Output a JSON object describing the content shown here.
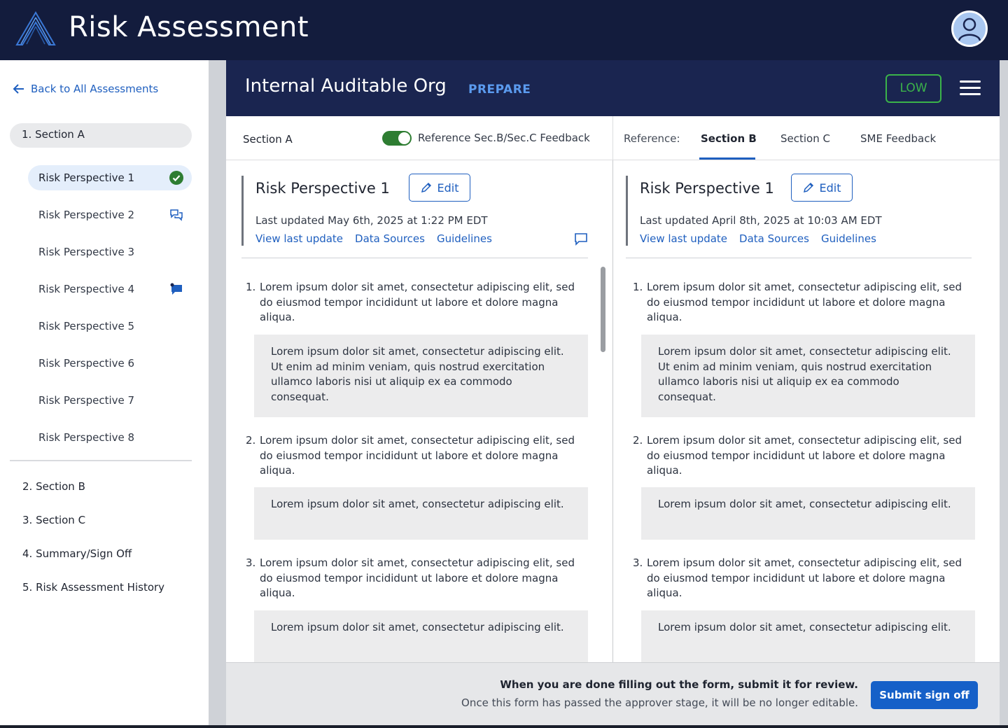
{
  "app": {
    "title": "Risk Assessment"
  },
  "sidebar": {
    "back_label": "Back to All Assessments",
    "current_section": "1. Section A",
    "perspectives": [
      {
        "label": "Risk Perspective 1",
        "status": "complete-check-icon",
        "active": true
      },
      {
        "label": "Risk Perspective 2",
        "status": "comments-outline-icon"
      },
      {
        "label": "Risk Perspective 3",
        "status": ""
      },
      {
        "label": "Risk Perspective 4",
        "status": "comment-filled-icon"
      },
      {
        "label": "Risk Perspective 5",
        "status": ""
      },
      {
        "label": "Risk Perspective 6",
        "status": ""
      },
      {
        "label": "Risk Perspective 7",
        "status": ""
      },
      {
        "label": "Risk Perspective 8",
        "status": ""
      }
    ],
    "sections": [
      "2. Section  B",
      "3. Section C",
      "4. Summary/Sign Off",
      "5. Risk Assessment History"
    ]
  },
  "header": {
    "org_name": "Internal Auditable Org",
    "stage": "PREPARE",
    "risk_level": "LOW",
    "risk_color": "#3bb34a"
  },
  "tabs": {
    "left_section": "Section A",
    "toggle_label": "Reference Sec.B/Sec.C Feedback",
    "toggle_on": true,
    "reference_label": "Reference:",
    "items": [
      "Section B",
      "Section C",
      "SME Feedback"
    ],
    "active": "Section B"
  },
  "left_panel": {
    "title": "Risk Perspective 1",
    "edit_label": "Edit",
    "last_updated": "Last updated May 6th, 2025 at 1:22 PM EDT",
    "links": [
      "View last update",
      "Data Sources",
      "Guidelines"
    ],
    "questions": [
      {
        "num": "1.",
        "text": "Lorem ipsum dolor sit amet, consectetur adipiscing elit, sed do eiusmod tempor incididunt ut labore et dolore magna aliqua.",
        "answer": "Lorem ipsum dolor sit amet, consectetur adipiscing elit. Ut enim ad minim veniam, quis nostrud exercitation ullamco laboris nisi ut aliquip ex ea commodo consequat."
      },
      {
        "num": "2.",
        "text": "Lorem ipsum dolor sit amet, consectetur adipiscing elit, sed do eiusmod tempor incididunt ut labore et dolore magna aliqua.",
        "answer": "Lorem ipsum dolor sit amet, consectetur adipiscing elit."
      },
      {
        "num": "3.",
        "text": "Lorem ipsum dolor sit amet, consectetur adipiscing elit, sed do eiusmod tempor incididunt ut labore et dolore magna aliqua.",
        "answer": "Lorem ipsum dolor sit amet, consectetur adipiscing elit."
      }
    ]
  },
  "right_panel": {
    "title": "Risk Perspective 1",
    "edit_label": "Edit",
    "last_updated": "Last updated April 8th, 2025 at 10:03 AM EDT",
    "links": [
      "View last update",
      "Data Sources",
      "Guidelines"
    ],
    "questions": [
      {
        "num": "1.",
        "text": "Lorem ipsum dolor sit amet, consectetur adipiscing elit, sed do eiusmod tempor incididunt ut labore et dolore magna aliqua.",
        "answer": "Lorem ipsum dolor sit amet, consectetur adipiscing elit. Ut enim ad minim veniam, quis nostrud exercitation ullamco laboris nisi ut aliquip ex ea commodo consequat."
      },
      {
        "num": "2.",
        "text": "Lorem ipsum dolor sit amet, consectetur adipiscing elit, sed do eiusmod tempor incididunt ut labore et dolore magna aliqua.",
        "answer": "Lorem ipsum dolor sit amet, consectetur adipiscing elit."
      },
      {
        "num": "3.",
        "text": "Lorem ipsum dolor sit amet, consectetur adipiscing elit, sed do eiusmod tempor incididunt ut labore et dolore magna aliqua.",
        "answer": "Lorem ipsum dolor sit amet, consectetur adipiscing elit."
      }
    ]
  },
  "footer": {
    "line1": "When you are done filling out the form, submit it for review.",
    "line2": "Once this form has passed the approver stage, it will be no longer editable.",
    "submit_label": "Submit sign off"
  },
  "colors": {
    "navy": "#131c3d",
    "header_band": "#1a2550",
    "link_blue": "#1f5fbf",
    "primary": "#1560c8",
    "success": "#2e7d32"
  }
}
